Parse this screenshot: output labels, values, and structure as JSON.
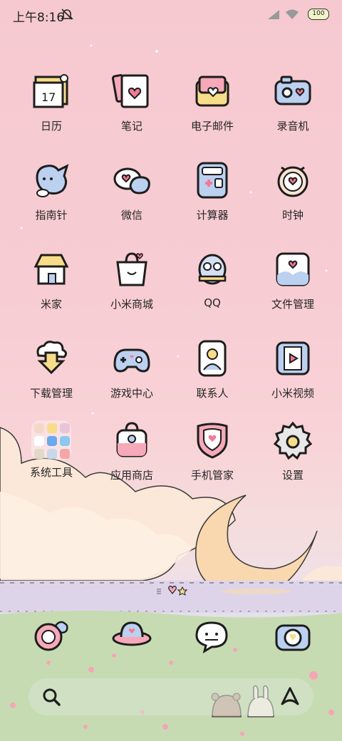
{
  "status_bar": {
    "time": "上午8:16",
    "battery": "100",
    "icons": [
      "mute-bell-icon",
      "signal-icon",
      "wifi-icon",
      "battery-icon"
    ]
  },
  "apps": [
    {
      "label": "日历",
      "icon": "calendar-icon"
    },
    {
      "label": "笔记",
      "icon": "notes-icon"
    },
    {
      "label": "电子邮件",
      "icon": "email-icon"
    },
    {
      "label": "录音机",
      "icon": "recorder-icon"
    },
    {
      "label": "指南针",
      "icon": "compass-icon"
    },
    {
      "label": "微信",
      "icon": "wechat-icon"
    },
    {
      "label": "计算器",
      "icon": "calculator-icon"
    },
    {
      "label": "时钟",
      "icon": "clock-icon"
    },
    {
      "label": "米家",
      "icon": "mihome-icon"
    },
    {
      "label": "小米商城",
      "icon": "mistore-icon"
    },
    {
      "label": "QQ",
      "icon": "qq-icon"
    },
    {
      "label": "文件管理",
      "icon": "file-manager-icon"
    },
    {
      "label": "下载管理",
      "icon": "download-icon"
    },
    {
      "label": "游戏中心",
      "icon": "gamepad-icon"
    },
    {
      "label": "联系人",
      "icon": "contacts-icon"
    },
    {
      "label": "小米视频",
      "icon": "video-icon"
    },
    {
      "label": "系统工具",
      "icon": "folder-icon"
    },
    {
      "label": "应用商店",
      "icon": "appstore-icon"
    },
    {
      "label": "手机管家",
      "icon": "security-icon"
    },
    {
      "label": "设置",
      "icon": "settings-icon"
    }
  ],
  "dock": [
    "phone-icon",
    "browser-icon",
    "messages-icon",
    "camera-icon"
  ],
  "search_bar": {
    "icons": [
      "search-icon",
      "assistant-icon"
    ]
  },
  "colors": {
    "accent": "#f27a95",
    "outline": "#1d1d1d",
    "yellow": "#f7dc8a",
    "blue": "#bcd0f0",
    "pink": "#f6a9b8"
  }
}
